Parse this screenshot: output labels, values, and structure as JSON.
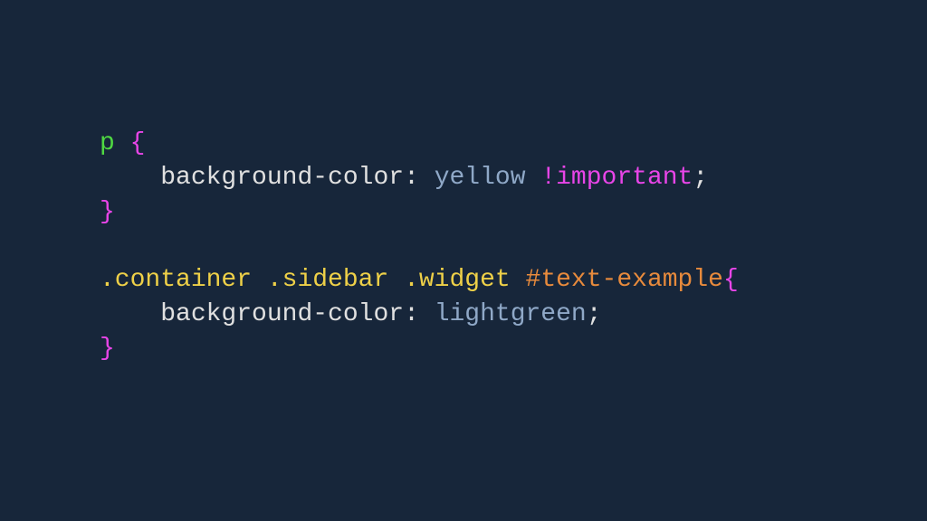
{
  "code": {
    "rule1": {
      "selector_tag": "p",
      "brace_open": "{",
      "property": "background-color",
      "colon": ":",
      "value": "yellow",
      "important": "!important",
      "semicolon": ";",
      "brace_close": "}",
      "indent": "    "
    },
    "rule2": {
      "selector_class1": ".container",
      "selector_class2": ".sidebar",
      "selector_class3": ".widget",
      "selector_id": "#text-example",
      "brace_open": "{",
      "property": "background-color",
      "colon": ":",
      "value": "lightgreen",
      "semicolon": ";",
      "brace_close": "}",
      "indent": "    "
    }
  }
}
